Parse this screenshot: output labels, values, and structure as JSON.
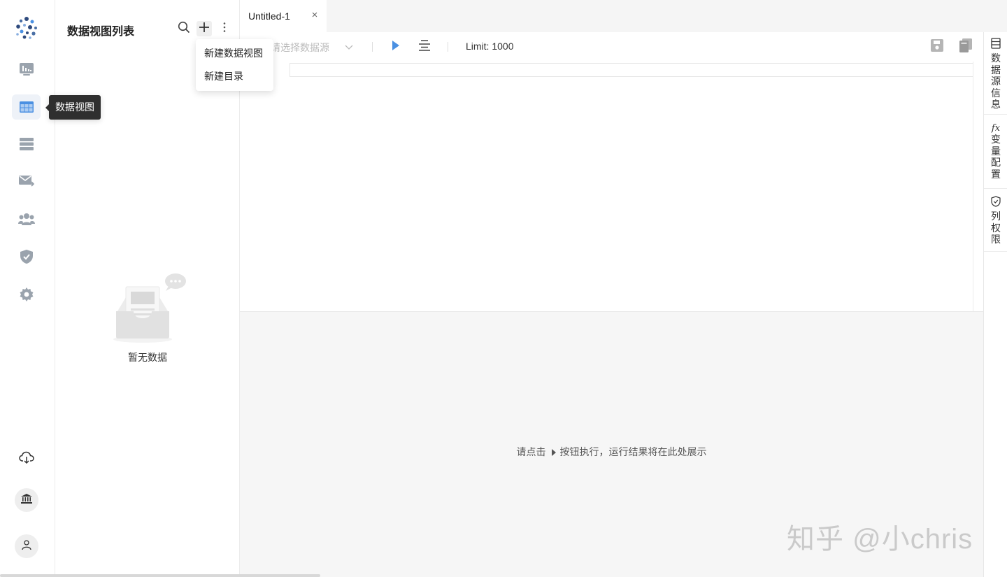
{
  "rail": {
    "items": [
      {
        "name": "dashboard"
      },
      {
        "name": "dataview",
        "active": true
      },
      {
        "name": "source"
      },
      {
        "name": "schedule"
      },
      {
        "name": "members"
      },
      {
        "name": "permission"
      },
      {
        "name": "settings"
      }
    ],
    "tooltip": "数据视图",
    "bottom": [
      "download",
      "organization",
      "profile"
    ]
  },
  "panel": {
    "title": "数据视图列表",
    "empty_text": "暂无数据"
  },
  "menu": {
    "items": [
      "新建数据视图",
      "新建目录"
    ]
  },
  "tabs": [
    {
      "label": "Untitled-1",
      "close": "×"
    }
  ],
  "toolbar": {
    "datasource_placeholder": "请选择数据源",
    "limit": "Limit: 1000"
  },
  "results": {
    "hint_before": "请点击",
    "hint_after": "按钮执行，运行结果将在此处展示"
  },
  "right_tabs": [
    {
      "label": "数据源信息"
    },
    {
      "label": "变量配置",
      "prefix": "fx"
    },
    {
      "label": "列权限"
    }
  ],
  "watermark": "知乎 @小chris",
  "colors": {
    "accent": "#4a90e2",
    "icon": "#9aa3ad",
    "tooltip_bg": "#2f2f2f",
    "results_bg": "#f6f6f6"
  }
}
